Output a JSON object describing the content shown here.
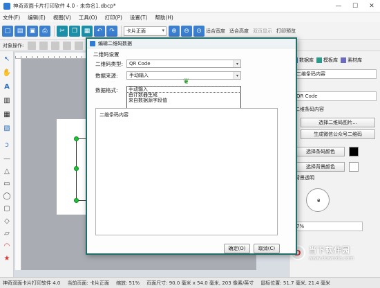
{
  "window": {
    "title": "神奇双面卡片打印软件 4.0 - 未命名1.dbcp*",
    "min": "—",
    "max": "☐",
    "close": "✕"
  },
  "menu": [
    "文件(F)",
    "编辑(E)",
    "视图(V)",
    "工具(O)",
    "打印(P)",
    "设置(T)",
    "帮助(H)"
  ],
  "toolbar": {
    "page_select": "卡片正面",
    "dist_h": "适合宽度",
    "dist_v": "适合高度",
    "two_page": "双页显示",
    "print_preview": "打印预览"
  },
  "ops": {
    "label": "对象操作:"
  },
  "right_panel": {
    "tabs": [
      "数据库",
      "模板库",
      "素材库"
    ],
    "content_field": "二维条码内容",
    "type_value": "QR Code",
    "content_label": "二维条码内容",
    "select_image_btn": "选择二维码图片...",
    "wechat_btn": "生成微信公众号二维码",
    "bar_color_btn": "选择条码颜色",
    "bg_color_btn": "选择背景颜色",
    "bg_transparent": "背景透明",
    "angle": "0",
    "zoom": "7%",
    "colors": {
      "bar": "#000000",
      "bg": "#ffffff"
    }
  },
  "dialog": {
    "title": "编辑二维码数据",
    "section": "二维码设置",
    "type_label": "二维码类型:",
    "type_value": "QR Code",
    "source_label": "数据来源:",
    "source_value": "手动输入",
    "format_label": "数据格式:",
    "source_options": [
      "手动输入",
      "由计数器生成",
      "来自数据源字段值"
    ],
    "content_caption": "二维条码内容",
    "ok": "确定(O)",
    "cancel": "取消(C)"
  },
  "status": {
    "app": "神奇双面卡片打印软件 4.0",
    "page": "当前页面: 卡片正面",
    "zoom": "缩放: 51%",
    "size": "页面尺寸: 90.0 毫米 x 54.0 毫米, 203 像素/英寸",
    "cursor": "鼠标位置: 51.7 毫米, 21.4 毫米"
  },
  "watermark": {
    "cn": "当下软件园",
    "url": "www.downxia.com",
    "logo": "D"
  }
}
